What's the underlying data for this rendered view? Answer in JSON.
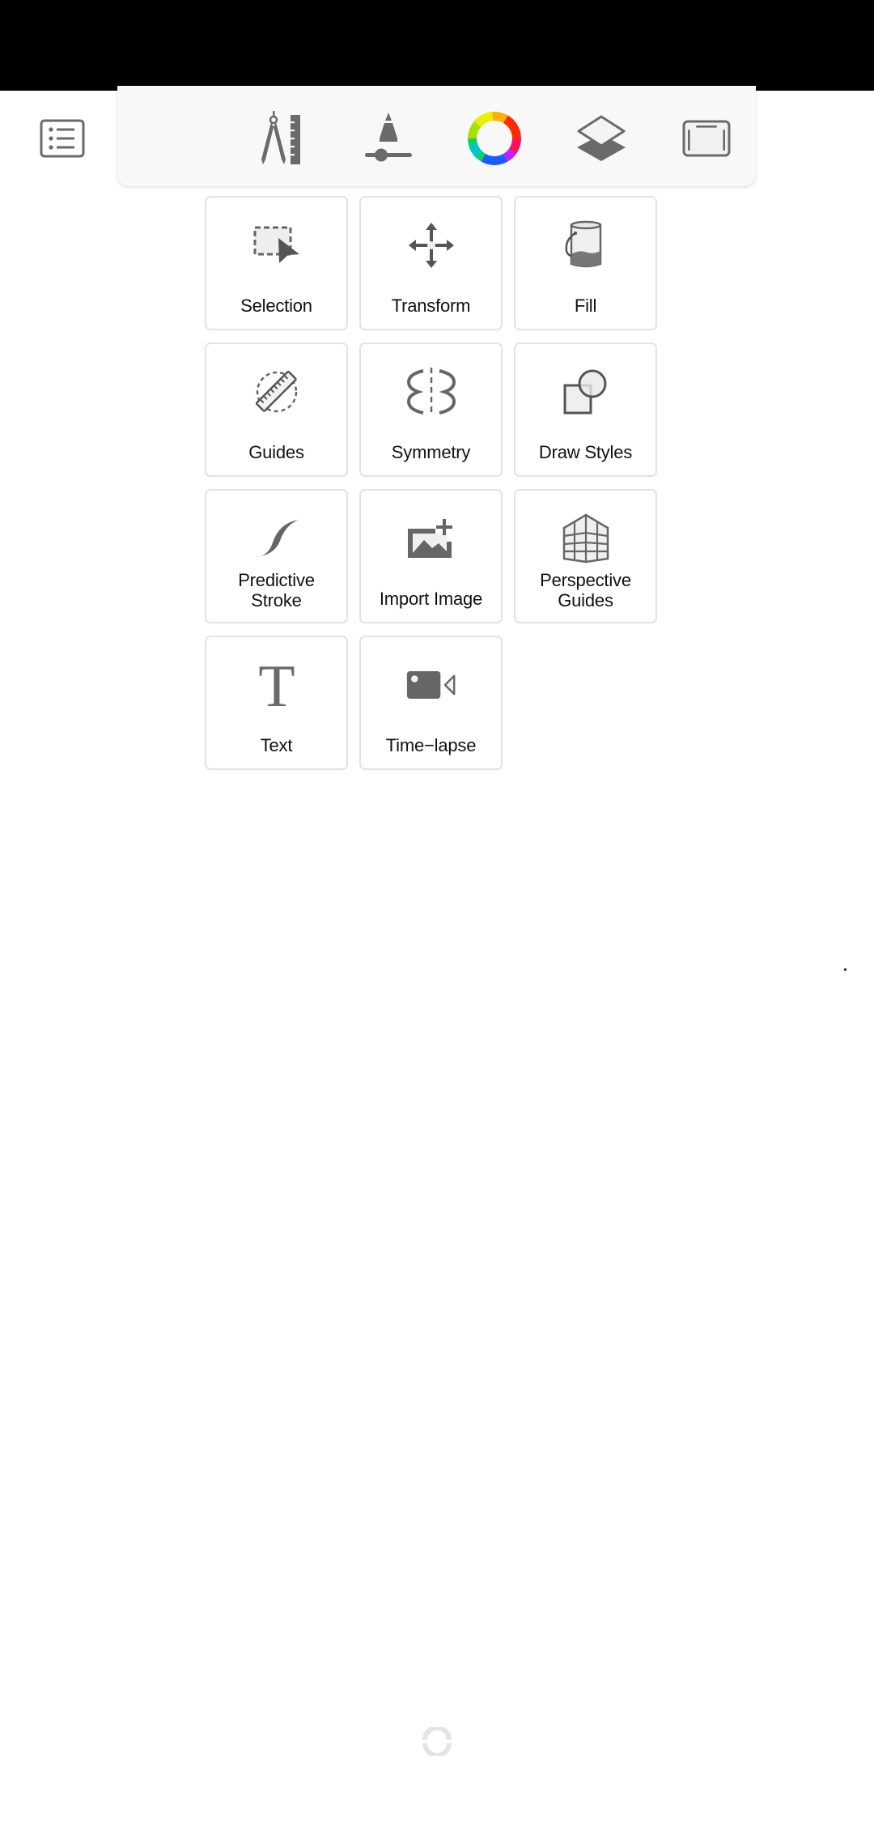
{
  "toolbar": {
    "items": [
      {
        "name": "list-menu",
        "icon": "list-icon"
      },
      {
        "name": "drawing-tools",
        "icon": "compass-ruler-icon"
      },
      {
        "name": "brush-properties",
        "icon": "brush-slider-icon"
      },
      {
        "name": "color-picker",
        "icon": "color-wheel-icon"
      },
      {
        "name": "layers",
        "icon": "layers-icon"
      },
      {
        "name": "canvas-fullscreen",
        "icon": "canvas-frame-icon"
      }
    ]
  },
  "tools": [
    {
      "label": "Selection",
      "icon": "selection-icon"
    },
    {
      "label": "Transform",
      "icon": "move-arrows-icon"
    },
    {
      "label": "Fill",
      "icon": "paint-bucket-icon"
    },
    {
      "label": "Guides",
      "icon": "ruler-guide-icon"
    },
    {
      "label": "Symmetry",
      "icon": "symmetry-icon"
    },
    {
      "label": "Draw Styles",
      "icon": "shapes-icon"
    },
    {
      "label": "Predictive Stroke",
      "line1": "Predictive",
      "line2": "Stroke",
      "icon": "curve-stroke-icon"
    },
    {
      "label": "Import Image",
      "icon": "add-image-icon"
    },
    {
      "label": "Perspective Guides",
      "line1": "Perspective",
      "line2": "Guides",
      "icon": "perspective-grid-icon"
    },
    {
      "label": "Text",
      "icon": "text-icon"
    },
    {
      "label": "Time−lapse",
      "icon": "video-camera-icon"
    }
  ],
  "colors": {
    "icon_gray": "#666666",
    "card_border": "#e3e3e3",
    "toolbar_bg": "#f8f8f8"
  }
}
